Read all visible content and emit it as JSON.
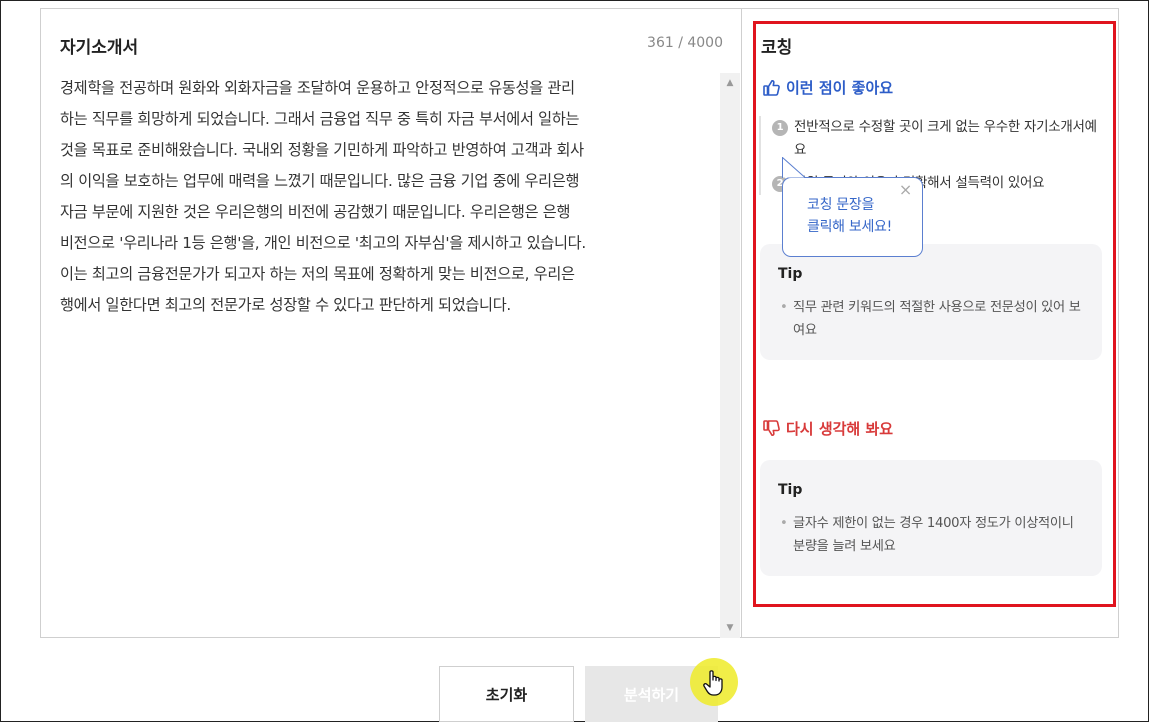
{
  "editor": {
    "title": "자기소개서",
    "char_count": "361 / 4000",
    "essay_text": "경제학을 전공하며 원화와 외화자금을 조달하여 운용하고 안정적으로 유동성을 관리\n하는 직무를 희망하게 되었습니다. 그래서 금융업 직무 중 특히 자금 부서에서 일하는\n것을 목표로 준비해왔습니다. 국내외 정황을 기민하게 파악하고 반영하여 고객과 회사\n의 이익을 보호하는 업무에 매력을 느꼈기 때문입니다. 많은 금융 기업 중에 우리은행\n자금 부문에 지원한 것은 우리은행의 비전에 공감했기 때문입니다. 우리은행은 은행\n비전으로 '우리나라 1등 은행'을, 개인 비전으로 '최고의 자부심'을 제시하고 있습니다.\n이는 최고의 금융전문가가 되고자 하는 저의 목표에 정확하게 맞는 비전으로, 우리은\n행에서 일한다면 최고의 전문가로 성장할 수 있다고 판단하게 되었습니다."
  },
  "coaching": {
    "title": "코칭",
    "good": {
      "heading": "이런 점이 좋아요",
      "items": [
        {
          "num": "1",
          "text": "전반적으로 수정할 곳이 크게 없는 우수한 자기소개서예요"
        },
        {
          "num": "2",
          "text": "지원 동기와 이유가 명확해서 설득력이 있어요"
        }
      ],
      "tip": {
        "label": "Tip",
        "text": "직무 관련 키워드의 적절한 사용으로 전문성이 있어 보여요"
      }
    },
    "bad": {
      "heading": "다시 생각해 봐요",
      "tip": {
        "label": "Tip",
        "text": "글자수 제한이 없는 경우 1400자 정도가 이상적이니 분량을 늘려 보세요"
      }
    }
  },
  "tooltip": {
    "text": "코칭 문장을\n클릭해 보세요!",
    "close": "×"
  },
  "buttons": {
    "reset": "초기화",
    "analyze": "분석하기"
  },
  "colors": {
    "highlight": "#e0141e",
    "good_accent": "#2d5dc8",
    "bad_accent": "#d83a3a",
    "cursor_highlight": "#eeeb28"
  },
  "icons": {
    "good": "thumbs-up-icon",
    "bad": "thumbs-down-icon",
    "cursor": "hand-pointer-icon"
  }
}
